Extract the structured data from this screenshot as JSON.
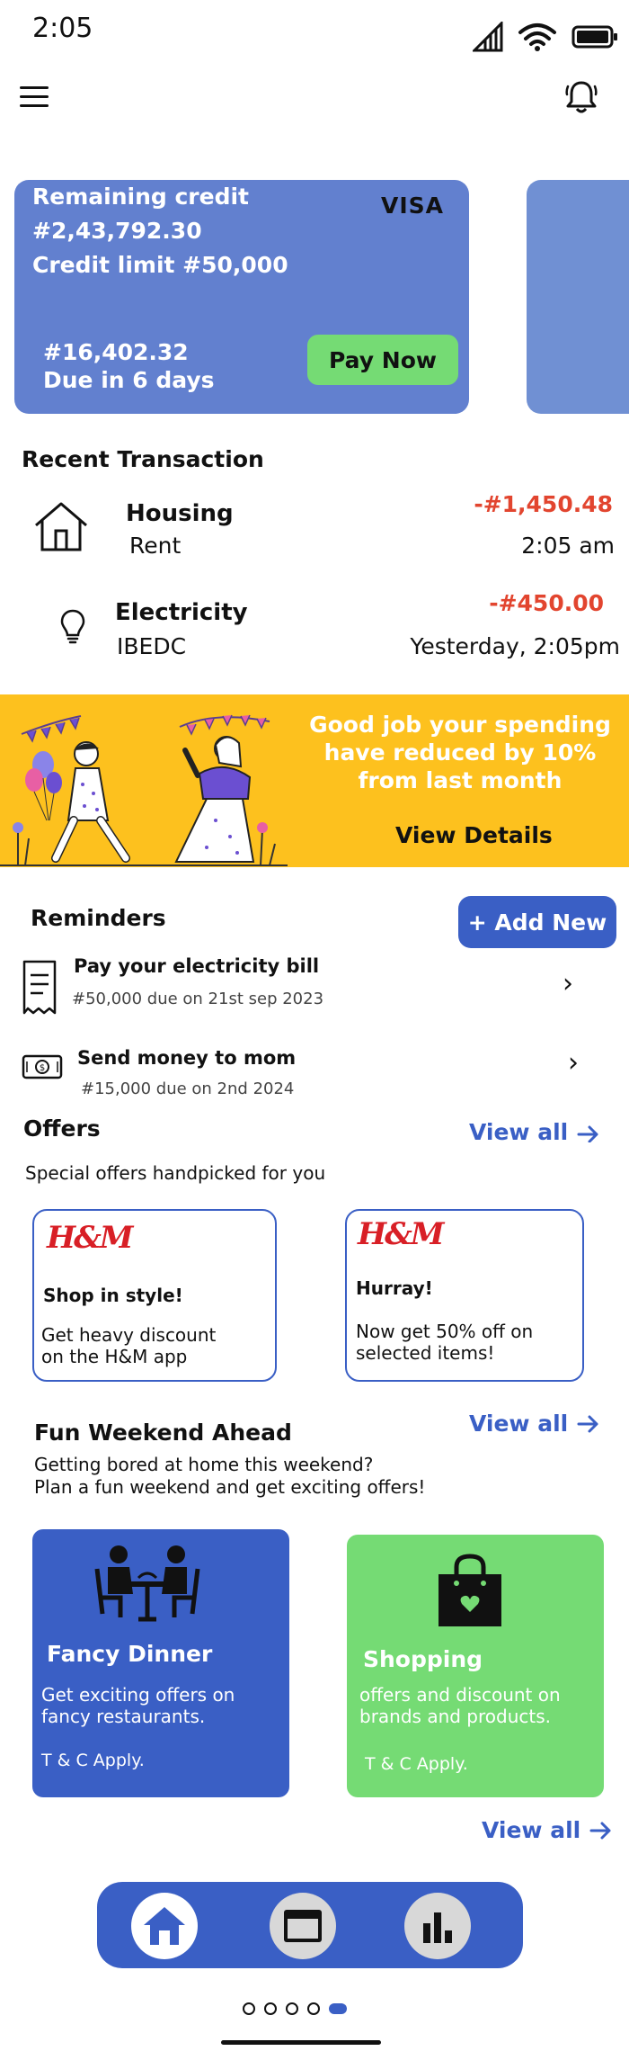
{
  "status_bar": {
    "time": "2:05"
  },
  "card": {
    "remaining_label": "Remaining credit",
    "remaining_amount": "#2,43,792.30",
    "credit_limit": "Credit limit #50,000",
    "brand": "VISA",
    "due_amount": "#16,402.32",
    "due_in": "Due in 6 days",
    "pay_button": "Pay Now"
  },
  "recent": {
    "title": "Recent Transaction",
    "items": [
      {
        "name": "Housing",
        "sub": "Rent",
        "amount": "-#1,450.48",
        "time": "2:05 am",
        "icon": "house-icon"
      },
      {
        "name": "Electricity",
        "sub": "IBEDC",
        "amount": "-#450.00",
        "time": "Yesterday, 2:05pm",
        "icon": "lightbulb-icon"
      }
    ]
  },
  "banner": {
    "message": "Good job your spending have reduced by 10% from last month",
    "link": "View Details"
  },
  "reminders": {
    "title": "Reminders",
    "add_button": "+ Add New",
    "items": [
      {
        "title": "Pay your electricity bill",
        "sub": "#50,000 due on 21st sep 2023",
        "icon": "receipt-icon"
      },
      {
        "title": "Send money to mom",
        "sub": "#15,000 due on 2nd 2024",
        "icon": "cash-icon"
      }
    ]
  },
  "offers": {
    "title": "Offers",
    "view_all": "View all",
    "subtitle": "Special offers handpicked for you",
    "items": [
      {
        "logo": "H&M",
        "title": "Shop in style!",
        "desc1": "Get heavy discount",
        "desc2": "on the  H&M app"
      },
      {
        "logo": "H&M",
        "title": "Hurray!",
        "desc1": "Now get 50% off on",
        "desc2": "selected items!"
      }
    ]
  },
  "weekend": {
    "title": "Fun Weekend Ahead",
    "view_all": "View all",
    "sub1": "Getting bored at home this weekend?",
    "sub2": "Plan a fun weekend and get exciting offers!",
    "cards": [
      {
        "title": "Fancy Dinner",
        "desc1": "Get exciting offers on",
        "desc2": "fancy restaurants.",
        "tc": "T & C Apply.",
        "color": "#3a5fc5"
      },
      {
        "title": "Shopping",
        "desc1": "offers and discount on",
        "desc2": "brands and products.",
        "tc": "T & C Apply.",
        "color": "#75db74"
      }
    ],
    "bottom_view_all": "View all"
  },
  "nav": {
    "items": [
      "home-icon",
      "card-icon",
      "chart-icon"
    ]
  },
  "colors": {
    "primary": "#3a5fc5",
    "card": "#6280cf",
    "accent_green": "#75db74",
    "banner": "#fdc11e",
    "debit": "#e2452f"
  }
}
